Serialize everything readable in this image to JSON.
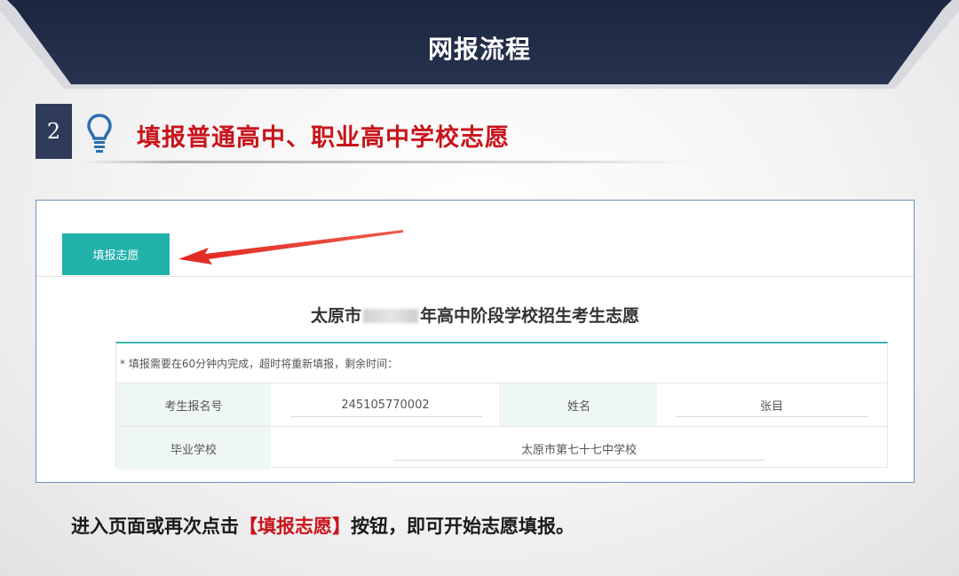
{
  "header": {
    "title": "网报流程"
  },
  "step": {
    "number": "2",
    "title": "填报普通高中、职业高中学校志愿"
  },
  "panel": {
    "tab_button_label": "填报志愿",
    "form_title_prefix": "太原市",
    "form_title_suffix": "年高中阶段学校招生考生志愿",
    "notice": "* 填报需要在60分钟内完成，超时将重新填报，剩余时间：",
    "fields": {
      "exam_id_label": "考生报名号",
      "exam_id_value": "245105770002",
      "name_label": "姓名",
      "name_value": "张目",
      "school_label": "毕业学校",
      "school_value": "太原市第七十七中学校"
    }
  },
  "caption": {
    "before": "进入页面或再次点击",
    "highlight": "【填报志愿】",
    "after": "按钮，即可开始志愿填报。"
  },
  "colors": {
    "banner": "#1f2a44",
    "accent_red": "#c8141b",
    "teal": "#21b1ab",
    "step_box": "#2f3b58"
  },
  "icons": {
    "bulb": "lightbulb-icon",
    "arrow": "red-arrow-icon"
  }
}
